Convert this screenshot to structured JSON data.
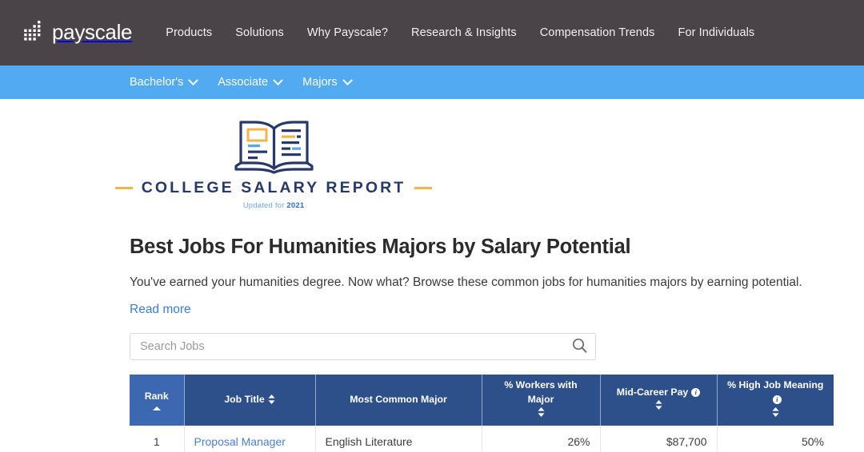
{
  "header": {
    "brand_name": "payscale",
    "logo_icon": "payscale-dot-matrix-logo",
    "nav": [
      {
        "label": "Products"
      },
      {
        "label": "Solutions"
      },
      {
        "label": "Why Payscale?"
      },
      {
        "label": "Research & Insights"
      },
      {
        "label": "Compensation Trends"
      },
      {
        "label": "For Individuals"
      }
    ]
  },
  "subnav": {
    "items": [
      {
        "label": "Bachelor's",
        "icon": "chevron-down-icon"
      },
      {
        "label": "Associate",
        "icon": "chevron-down-icon"
      },
      {
        "label": "Majors",
        "icon": "chevron-down-icon"
      }
    ]
  },
  "report_logo": {
    "icon": "open-book-icon",
    "title": "COLLEGE SALARY REPORT",
    "updated_prefix": "Updated for ",
    "updated_year": "2021",
    "accent_color": "#f0b44a",
    "title_color": "#27386b"
  },
  "main": {
    "page_title": "Best Jobs For Humanities Majors by Salary Potential",
    "lede": "You've earned your humanities degree. Now what? Browse these common jobs for humanities majors by earning potential.",
    "read_more": "Read more"
  },
  "search": {
    "placeholder": "Search Jobs",
    "value": "",
    "icon": "search-icon"
  },
  "table": {
    "columns": [
      {
        "label": "Rank",
        "sort": "asc",
        "active": true
      },
      {
        "label": "Job Title",
        "sort": "both",
        "active": false
      },
      {
        "label": "Most Common Major",
        "sort": "none",
        "active": false
      },
      {
        "label": "% Workers with Major",
        "sort": "both",
        "active": false
      },
      {
        "label": "Mid-Career Pay",
        "sort": "both",
        "info": true,
        "active": false
      },
      {
        "label": "% High Job Meaning",
        "sort": "both",
        "info": true,
        "active": false
      }
    ],
    "rows": [
      {
        "rank": "1",
        "job_title": "Proposal Manager",
        "most_common_major": "English Literature",
        "pct_workers_with_major": "26%",
        "mid_career_pay": "$87,700",
        "pct_high_job_meaning": "50%"
      }
    ],
    "header_bg": "#2d4f8a",
    "active_header_bg": "#3b68b0"
  }
}
